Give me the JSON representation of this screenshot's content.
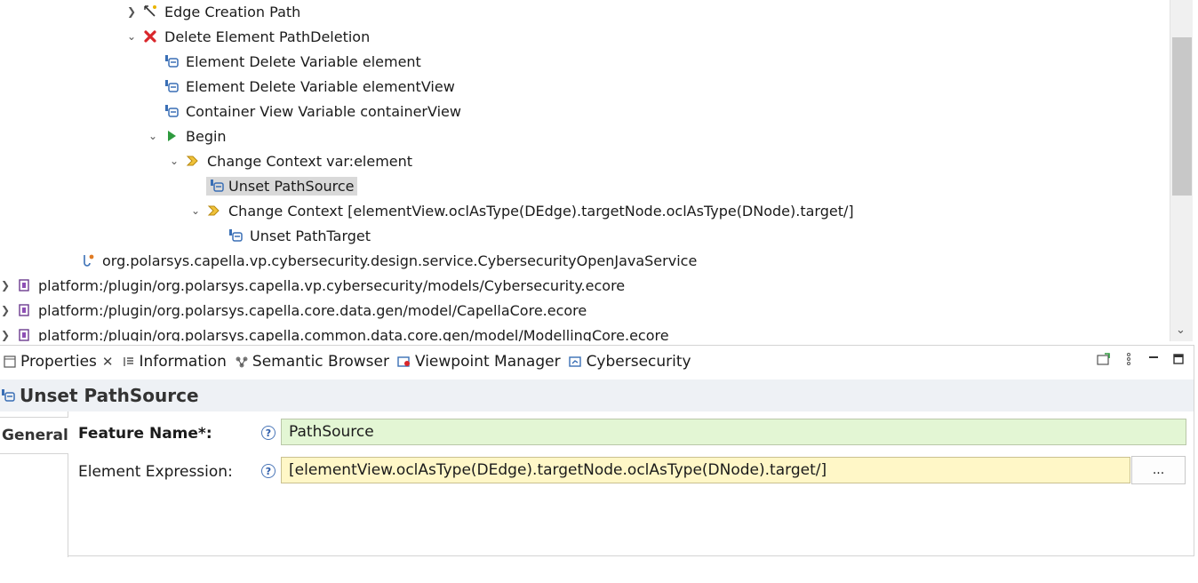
{
  "tree": {
    "rows": [
      {
        "label": "Edge Creation Path",
        "icon": "edge-creation-icon",
        "toggle": ">"
      },
      {
        "label": "Delete Element PathDeletion",
        "icon": "delete-red-x-icon",
        "toggle": "v"
      },
      {
        "label": "Element Delete Variable element",
        "icon": "variable-icon",
        "toggle": ""
      },
      {
        "label": "Element Delete Variable elementView",
        "icon": "variable-icon",
        "toggle": ""
      },
      {
        "label": "Container View Variable containerView",
        "icon": "variable-icon",
        "toggle": ""
      },
      {
        "label": "Begin",
        "icon": "begin-play-icon",
        "toggle": "v"
      },
      {
        "label": "Change Context var:element",
        "icon": "change-context-icon",
        "toggle": "v"
      },
      {
        "label": "Unset PathSource",
        "icon": "unset-icon",
        "toggle": "",
        "selected": true
      },
      {
        "label": "Change Context [elementView.oclAsType(DEdge).targetNode.oclAsType(DNode).target/]",
        "icon": "change-context-icon",
        "toggle": "v"
      },
      {
        "label": "Unset PathTarget",
        "icon": "unset-icon",
        "toggle": ""
      },
      {
        "label": "org.polarsys.capella.vp.cybersecurity.design.service.CybersecurityOpenJavaService",
        "icon": "java-service-icon",
        "toggle": ""
      },
      {
        "label": "platform:/plugin/org.polarsys.capella.vp.cybersecurity/models/Cybersecurity.ecore",
        "icon": "ecore-package-icon",
        "toggle": ">"
      },
      {
        "label": "platform:/plugin/org.polarsys.capella.core.data.gen/model/CapellaCore.ecore",
        "icon": "ecore-package-icon",
        "toggle": ">"
      },
      {
        "label": "platform:/plugin/org.polarsys.capella.common.data.core.gen/model/ModellingCore.ecore",
        "icon": "ecore-package-icon",
        "toggle": ">"
      }
    ]
  },
  "tabs": [
    {
      "label": "Properties",
      "icon": "properties-icon",
      "closable": true
    },
    {
      "label": "Information",
      "icon": "information-icon",
      "closable": false
    },
    {
      "label": "Semantic Browser",
      "icon": "semantic-browser-icon",
      "closable": false
    },
    {
      "label": "Viewpoint Manager",
      "icon": "viewpoint-manager-icon",
      "closable": false
    },
    {
      "label": "Cybersecurity",
      "icon": "cybersecurity-icon",
      "closable": false
    }
  ],
  "properties": {
    "title": "Unset PathSource",
    "section_tab": "General",
    "feature_name_label": "Feature Name*:",
    "feature_name_value": "PathSource",
    "element_expression_label": "Element Expression:",
    "element_expression_value": "[elementView.oclAsType(DEdge).targetNode.oclAsType(DNode).target/]",
    "browse_label": "...",
    "help_glyph": "?"
  },
  "colors": {
    "selection": "#d9d9d9",
    "feature_field_bg": "#e3f6d4",
    "expression_field_bg": "#fff7c7",
    "title_bar_bg": "#eef1f5"
  }
}
